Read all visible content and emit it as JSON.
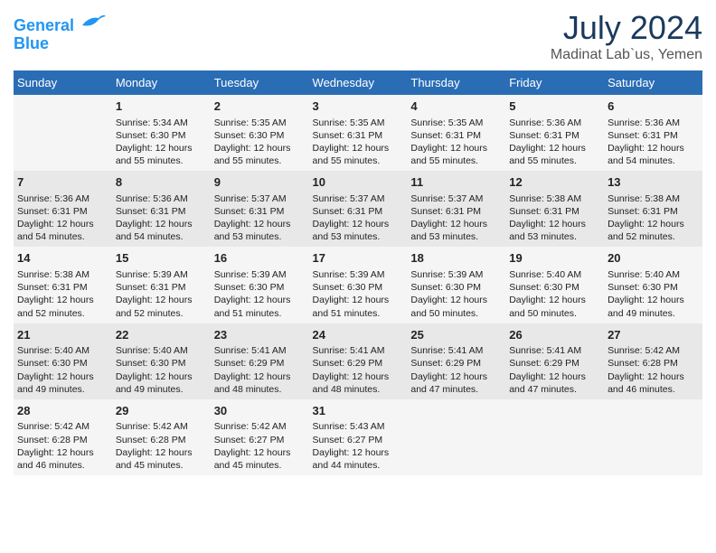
{
  "header": {
    "logo_line1": "General",
    "logo_line2": "Blue",
    "month_year": "July 2024",
    "location": "Madinat Lab`us, Yemen"
  },
  "weekdays": [
    "Sunday",
    "Monday",
    "Tuesday",
    "Wednesday",
    "Thursday",
    "Friday",
    "Saturday"
  ],
  "weeks": [
    [
      {
        "day": "",
        "info": ""
      },
      {
        "day": "1",
        "info": "Sunrise: 5:34 AM\nSunset: 6:30 PM\nDaylight: 12 hours\nand 55 minutes."
      },
      {
        "day": "2",
        "info": "Sunrise: 5:35 AM\nSunset: 6:30 PM\nDaylight: 12 hours\nand 55 minutes."
      },
      {
        "day": "3",
        "info": "Sunrise: 5:35 AM\nSunset: 6:31 PM\nDaylight: 12 hours\nand 55 minutes."
      },
      {
        "day": "4",
        "info": "Sunrise: 5:35 AM\nSunset: 6:31 PM\nDaylight: 12 hours\nand 55 minutes."
      },
      {
        "day": "5",
        "info": "Sunrise: 5:36 AM\nSunset: 6:31 PM\nDaylight: 12 hours\nand 55 minutes."
      },
      {
        "day": "6",
        "info": "Sunrise: 5:36 AM\nSunset: 6:31 PM\nDaylight: 12 hours\nand 54 minutes."
      }
    ],
    [
      {
        "day": "7",
        "info": "Sunrise: 5:36 AM\nSunset: 6:31 PM\nDaylight: 12 hours\nand 54 minutes."
      },
      {
        "day": "8",
        "info": "Sunrise: 5:36 AM\nSunset: 6:31 PM\nDaylight: 12 hours\nand 54 minutes."
      },
      {
        "day": "9",
        "info": "Sunrise: 5:37 AM\nSunset: 6:31 PM\nDaylight: 12 hours\nand 53 minutes."
      },
      {
        "day": "10",
        "info": "Sunrise: 5:37 AM\nSunset: 6:31 PM\nDaylight: 12 hours\nand 53 minutes."
      },
      {
        "day": "11",
        "info": "Sunrise: 5:37 AM\nSunset: 6:31 PM\nDaylight: 12 hours\nand 53 minutes."
      },
      {
        "day": "12",
        "info": "Sunrise: 5:38 AM\nSunset: 6:31 PM\nDaylight: 12 hours\nand 53 minutes."
      },
      {
        "day": "13",
        "info": "Sunrise: 5:38 AM\nSunset: 6:31 PM\nDaylight: 12 hours\nand 52 minutes."
      }
    ],
    [
      {
        "day": "14",
        "info": "Sunrise: 5:38 AM\nSunset: 6:31 PM\nDaylight: 12 hours\nand 52 minutes."
      },
      {
        "day": "15",
        "info": "Sunrise: 5:39 AM\nSunset: 6:31 PM\nDaylight: 12 hours\nand 52 minutes."
      },
      {
        "day": "16",
        "info": "Sunrise: 5:39 AM\nSunset: 6:30 PM\nDaylight: 12 hours\nand 51 minutes."
      },
      {
        "day": "17",
        "info": "Sunrise: 5:39 AM\nSunset: 6:30 PM\nDaylight: 12 hours\nand 51 minutes."
      },
      {
        "day": "18",
        "info": "Sunrise: 5:39 AM\nSunset: 6:30 PM\nDaylight: 12 hours\nand 50 minutes."
      },
      {
        "day": "19",
        "info": "Sunrise: 5:40 AM\nSunset: 6:30 PM\nDaylight: 12 hours\nand 50 minutes."
      },
      {
        "day": "20",
        "info": "Sunrise: 5:40 AM\nSunset: 6:30 PM\nDaylight: 12 hours\nand 49 minutes."
      }
    ],
    [
      {
        "day": "21",
        "info": "Sunrise: 5:40 AM\nSunset: 6:30 PM\nDaylight: 12 hours\nand 49 minutes."
      },
      {
        "day": "22",
        "info": "Sunrise: 5:40 AM\nSunset: 6:30 PM\nDaylight: 12 hours\nand 49 minutes."
      },
      {
        "day": "23",
        "info": "Sunrise: 5:41 AM\nSunset: 6:29 PM\nDaylight: 12 hours\nand 48 minutes."
      },
      {
        "day": "24",
        "info": "Sunrise: 5:41 AM\nSunset: 6:29 PM\nDaylight: 12 hours\nand 48 minutes."
      },
      {
        "day": "25",
        "info": "Sunrise: 5:41 AM\nSunset: 6:29 PM\nDaylight: 12 hours\nand 47 minutes."
      },
      {
        "day": "26",
        "info": "Sunrise: 5:41 AM\nSunset: 6:29 PM\nDaylight: 12 hours\nand 47 minutes."
      },
      {
        "day": "27",
        "info": "Sunrise: 5:42 AM\nSunset: 6:28 PM\nDaylight: 12 hours\nand 46 minutes."
      }
    ],
    [
      {
        "day": "28",
        "info": "Sunrise: 5:42 AM\nSunset: 6:28 PM\nDaylight: 12 hours\nand 46 minutes."
      },
      {
        "day": "29",
        "info": "Sunrise: 5:42 AM\nSunset: 6:28 PM\nDaylight: 12 hours\nand 45 minutes."
      },
      {
        "day": "30",
        "info": "Sunrise: 5:42 AM\nSunset: 6:27 PM\nDaylight: 12 hours\nand 45 minutes."
      },
      {
        "day": "31",
        "info": "Sunrise: 5:43 AM\nSunset: 6:27 PM\nDaylight: 12 hours\nand 44 minutes."
      },
      {
        "day": "",
        "info": ""
      },
      {
        "day": "",
        "info": ""
      },
      {
        "day": "",
        "info": ""
      }
    ]
  ]
}
